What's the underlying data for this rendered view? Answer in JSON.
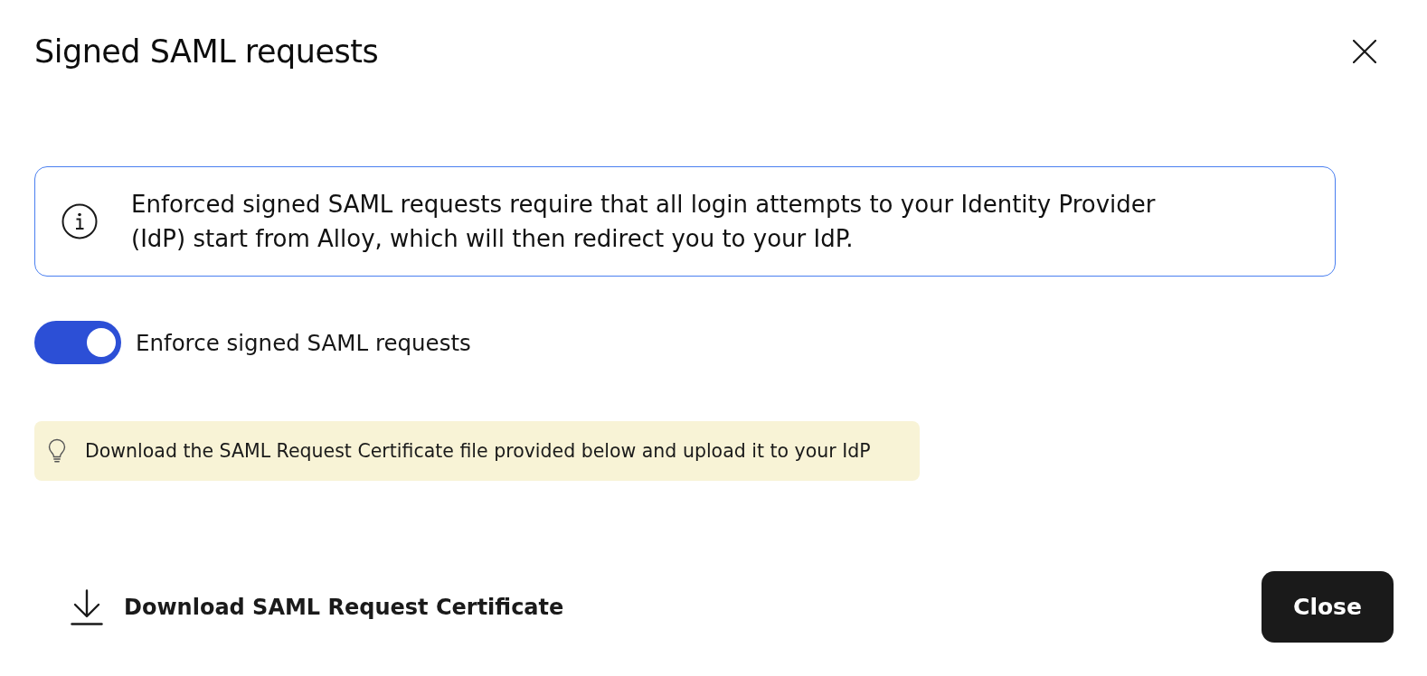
{
  "dialog": {
    "title": "Signed SAML requests"
  },
  "info_banner": {
    "text": "Enforced signed SAML requests require that all login attempts to your Identity Provider (IdP) start from Alloy, which will then redirect you to your IdP."
  },
  "toggle": {
    "label": "Enforce signed SAML requests",
    "on": true
  },
  "tip": {
    "text": "Download the SAML Request Certificate file provided below and upload it to your IdP"
  },
  "footer": {
    "download_link": "Download SAML Request Certificate",
    "close_button": "Close"
  }
}
